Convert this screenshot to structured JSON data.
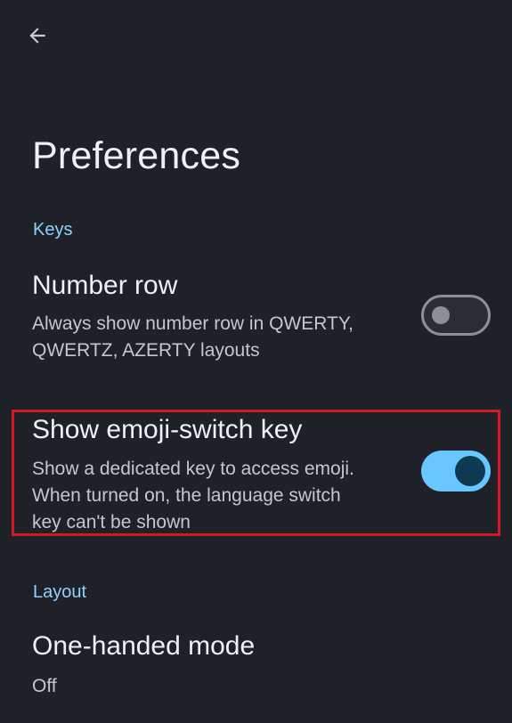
{
  "header": {
    "back_icon": "arrow-left-icon",
    "title": "Preferences"
  },
  "sections": {
    "keys": {
      "label": "Keys",
      "number_row": {
        "title": "Number row",
        "description": "Always show number row in QWERTY,\nQWERTZ, AZERTY layouts",
        "enabled": false
      },
      "emoji_switch": {
        "title": "Show emoji-switch key",
        "description": "Show a dedicated key to access emoji.\nWhen turned on, the language switch\nkey can't be shown",
        "enabled": true
      }
    },
    "layout": {
      "label": "Layout",
      "one_handed": {
        "title": "One-handed mode",
        "value": "Off"
      }
    }
  },
  "colors": {
    "background": "#1f2128",
    "accent": "#8fd0ff",
    "toggle_on_track": "#6ac6ff",
    "highlight": "#d21a26"
  }
}
